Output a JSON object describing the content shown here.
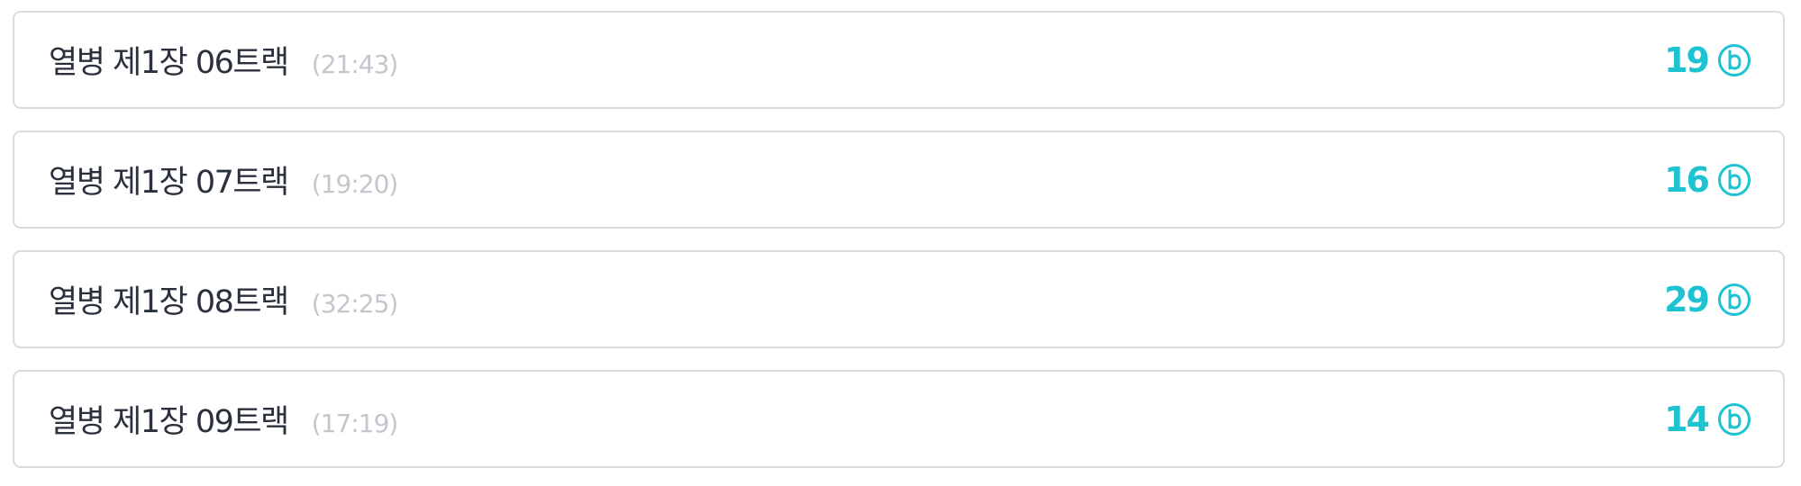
{
  "tracks": [
    {
      "title": "열병 제1장 06트랙",
      "duration": "(21:43)",
      "price": "19"
    },
    {
      "title": "열병 제1장 07트랙",
      "duration": "(19:20)",
      "price": "16"
    },
    {
      "title": "열병 제1장 08트랙",
      "duration": "(32:25)",
      "price": "29"
    },
    {
      "title": "열병 제1장 09트랙",
      "duration": "(17:19)",
      "price": "14"
    }
  ],
  "colors": {
    "accent": "#1ec3d2",
    "title": "#2b313c",
    "duration": "#c3c7cd",
    "border": "#d9dbdf"
  },
  "icons": {
    "coin": "coin-b-icon"
  }
}
